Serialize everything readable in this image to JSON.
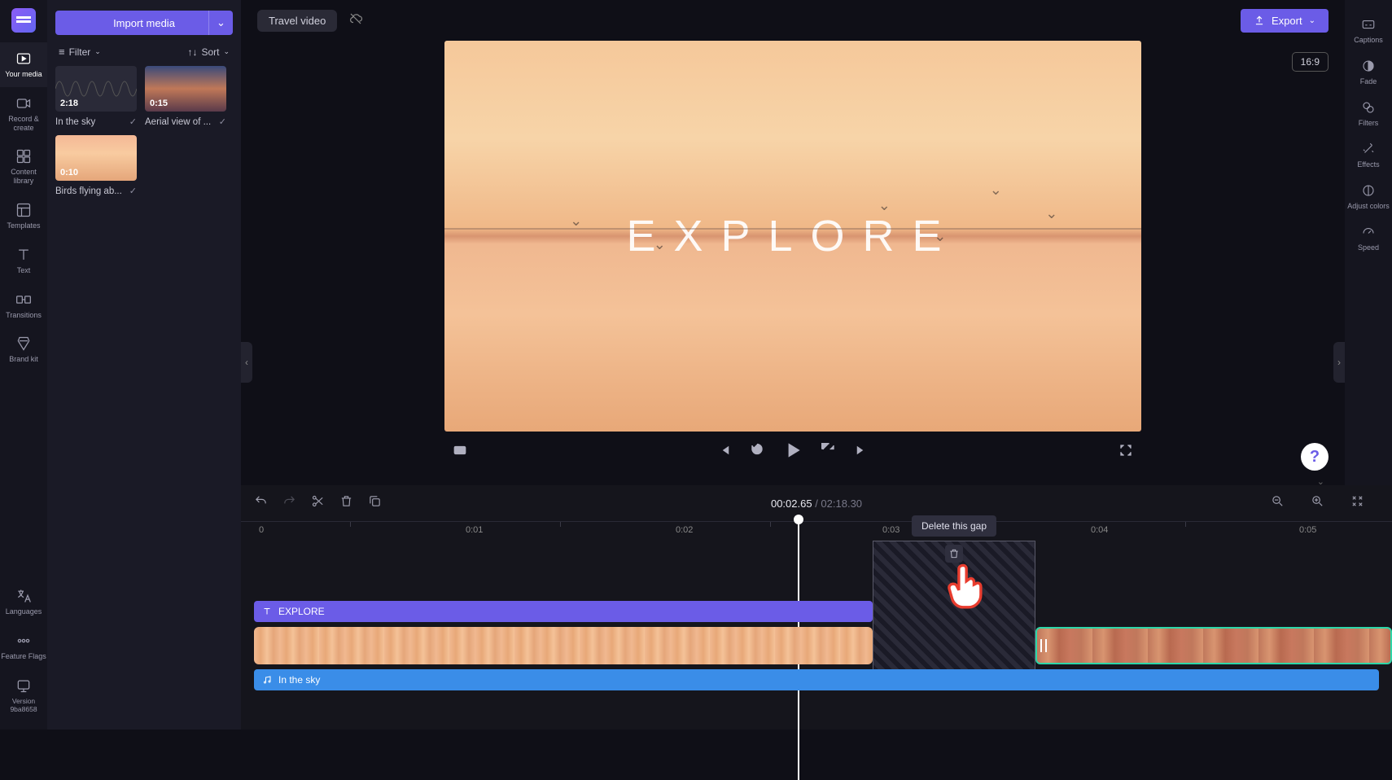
{
  "colors": {
    "accent": "#6b5ce7",
    "bg": "#0f0f17",
    "panel": "#1a1a26"
  },
  "left_rail": {
    "items": [
      {
        "label": "Your media",
        "icon": "media-icon"
      },
      {
        "label": "Record & create",
        "icon": "record-icon"
      },
      {
        "label": "Content library",
        "icon": "content-library-icon"
      },
      {
        "label": "Templates",
        "icon": "templates-icon"
      },
      {
        "label": "Text",
        "icon": "text-icon"
      },
      {
        "label": "Transitions",
        "icon": "transitions-icon"
      },
      {
        "label": "Brand kit",
        "icon": "brand-kit-icon"
      }
    ],
    "bottom": [
      {
        "label": "Languages",
        "icon": "languages-icon"
      },
      {
        "label": "Feature Flags",
        "icon": "flags-icon"
      },
      {
        "label": "Version 9ba8658",
        "icon": "version-icon"
      }
    ]
  },
  "media_panel": {
    "import_label": "Import media",
    "filter_label": "Filter",
    "sort_label": "Sort",
    "items": [
      {
        "duration": "2:18",
        "label": "In the sky",
        "thumb": "audio"
      },
      {
        "duration": "0:15",
        "label": "Aerial view of ...",
        "thumb": "mountains"
      },
      {
        "duration": "0:10",
        "label": "Birds flying ab...",
        "thumb": "birds"
      }
    ]
  },
  "topbar": {
    "project_name": "Travel video",
    "export_label": "Export"
  },
  "right_rail": {
    "items": [
      {
        "label": "Captions",
        "icon": "captions-icon"
      },
      {
        "label": "Fade",
        "icon": "fade-icon"
      },
      {
        "label": "Filters",
        "icon": "filters-icon"
      },
      {
        "label": "Effects",
        "icon": "effects-icon"
      },
      {
        "label": "Adjust colors",
        "icon": "adjust-colors-icon"
      },
      {
        "label": "Speed",
        "icon": "speed-icon"
      }
    ]
  },
  "preview": {
    "aspect_ratio": "16:9",
    "overlay_text": "EXPLORE"
  },
  "timeline": {
    "current_time": "00:02.65",
    "total_time": "02:18.30",
    "ruler": [
      "0",
      "0:01",
      "0:02",
      "0:03",
      "0:04",
      "0:05"
    ],
    "text_track_label": "EXPLORE",
    "audio_track_label": "In the sky",
    "gap_tooltip": "Delete this gap"
  }
}
